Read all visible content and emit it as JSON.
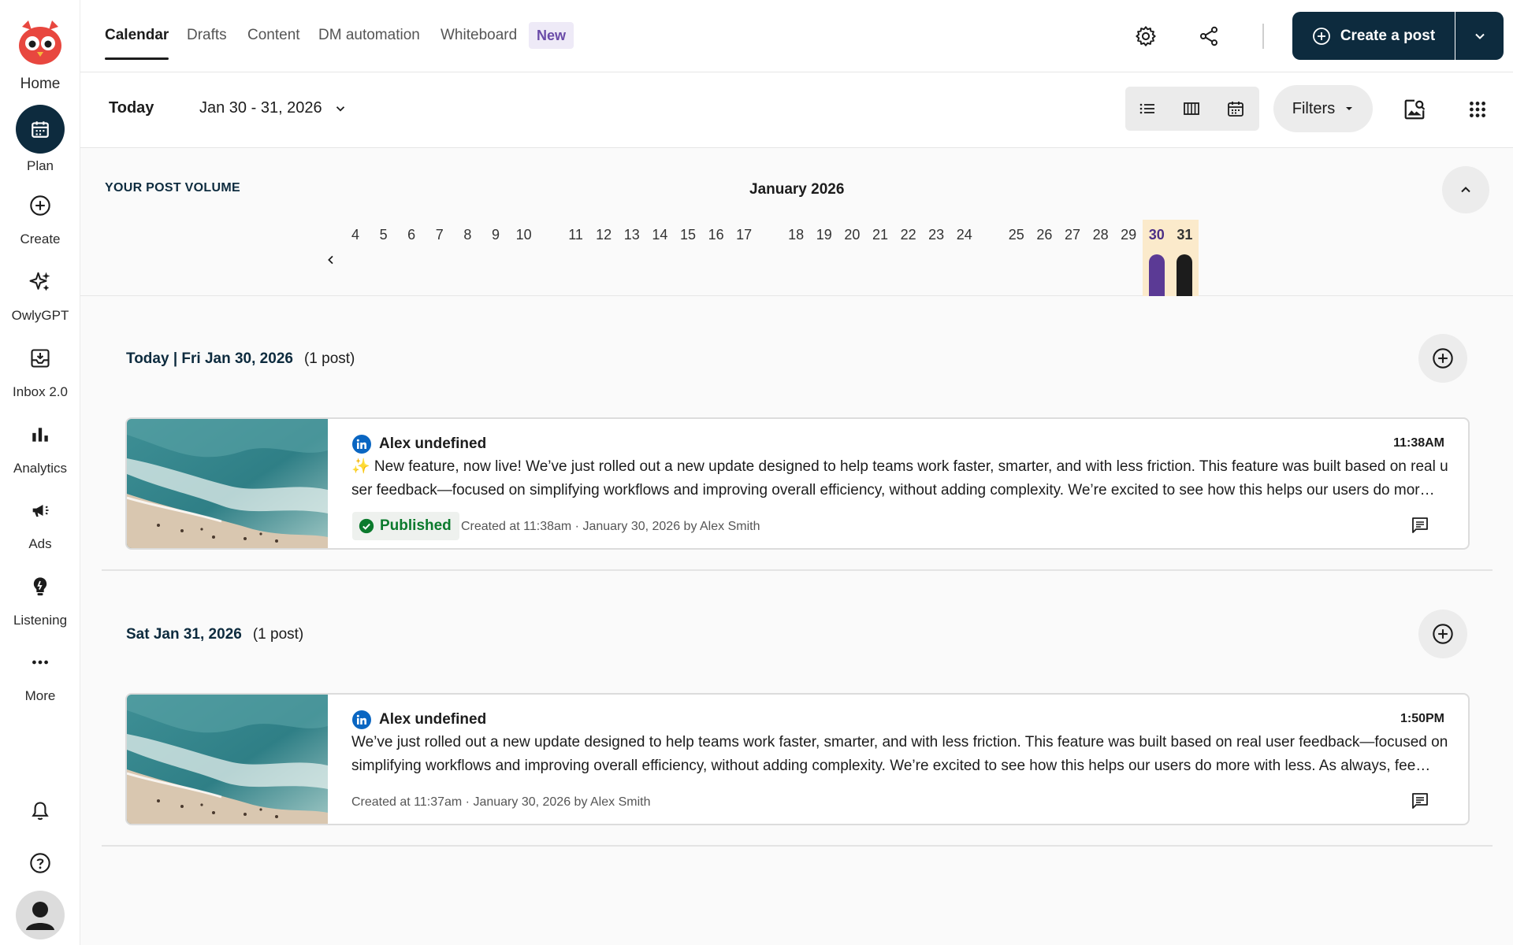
{
  "rail": {
    "home_label": "Home",
    "items": [
      {
        "label": "Plan",
        "icon": "calendar-icon"
      },
      {
        "label": "Create",
        "icon": "plus-circle-icon"
      },
      {
        "label": "OwlyGPT",
        "icon": "sparkle-icon"
      },
      {
        "label": "Inbox 2.0",
        "icon": "inbox-icon"
      },
      {
        "label": "Analytics",
        "icon": "bar-chart-icon"
      },
      {
        "label": "Ads",
        "icon": "megaphone-icon"
      },
      {
        "label": "Listening",
        "icon": "lightbulb-icon"
      },
      {
        "label": "More",
        "icon": "more-dots-icon"
      }
    ]
  },
  "topnav": {
    "tabs": [
      "Calendar",
      "Drafts",
      "Content",
      "DM automation",
      "Whiteboard"
    ],
    "new_badge": "New",
    "create_label": "Create a post"
  },
  "toolbar": {
    "today": "Today",
    "date_range": "Jan 30 - 31, 2026",
    "filters": "Filters"
  },
  "volume": {
    "title": "YOUR POST VOLUME",
    "month": "January 2026",
    "days": [
      "4",
      "5",
      "6",
      "7",
      "8",
      "9",
      "10",
      "11",
      "12",
      "13",
      "14",
      "15",
      "16",
      "17",
      "18",
      "19",
      "20",
      "21",
      "22",
      "23",
      "24",
      "25",
      "26",
      "27",
      "28",
      "29",
      "30",
      "31"
    ],
    "highlighted_days": [
      "30",
      "31"
    ],
    "bar_colors": {
      "30": "#5b3a95",
      "31": "#1c1c1c"
    },
    "highlight_color": "#fbeacb"
  },
  "sections": [
    {
      "date": "Today | Fri Jan 30, 2026",
      "count": "(1 post)",
      "post": {
        "author": "Alex undefined",
        "time": "11:38AM",
        "line1": "✨ New feature, now live! We’ve just rolled out a new update designed to help teams work faster, smarter, and with less friction. This feature was built based on real u",
        "line2": "ser feedback—focused on simplifying workflows and improving overall efficiency, without adding complexity. We’re excited to see how this helps our users do mor…",
        "status": "Published",
        "created": "Created at 11:38am · January 30, 2026 by Alex Smith"
      }
    },
    {
      "date": "Sat Jan 31, 2026",
      "count": "(1 post)",
      "post": {
        "author": "Alex undefined",
        "time": "1:50PM",
        "line1": "We’ve just rolled out a new update designed to help teams work faster, smarter, and with less friction. This feature was built based on real user feedback—focused on",
        "line2": "simplifying workflows and improving overall efficiency, without adding complexity. We’re excited to see how this helps our users do more with less. As always, fee…",
        "status": "",
        "created": "Created at 11:37am · January 30, 2026 by Alex Smith"
      }
    }
  ]
}
